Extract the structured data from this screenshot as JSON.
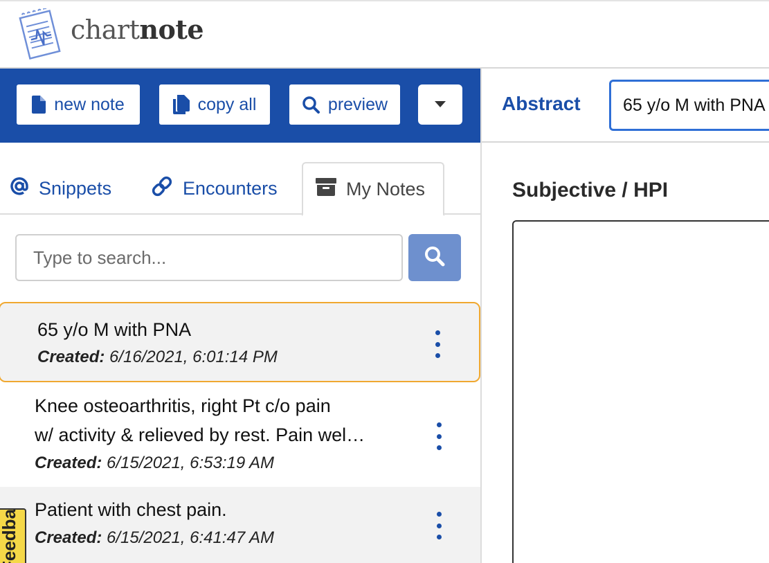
{
  "app": {
    "logo_light": "chart",
    "logo_bold": "note"
  },
  "toolbar": {
    "new_note_label": "new note",
    "copy_all_label": "copy all",
    "preview_label": "preview",
    "accent_color": "#1a4ea8"
  },
  "abstract": {
    "label": "Abstract",
    "value": "65 y/o M with PNA"
  },
  "tabs": [
    {
      "label": "Snippets",
      "icon": "at-icon"
    },
    {
      "label": "Encounters",
      "icon": "link-icon"
    },
    {
      "label": "My Notes",
      "icon": "archive-icon",
      "active": true
    }
  ],
  "search": {
    "placeholder": "Type to search..."
  },
  "notes": [
    {
      "title": "65 y/o M with PNA",
      "created_label": "Created:",
      "created": "6/16/2021, 6:01:14 PM",
      "selected": true
    },
    {
      "title_line1": "Knee osteoarthritis, right Pt c/o pain",
      "title_line2": "w/ activity & relieved by rest. Pain wel…",
      "created_label": "Created:",
      "created": "6/15/2021, 6:53:19 AM"
    },
    {
      "title": "Patient with chest pain.",
      "created_label": "Created:",
      "created": "6/15/2021, 6:41:47 AM"
    }
  ],
  "feedback": {
    "label": "Feedback"
  },
  "editor": {
    "section_title": "Subjective / HPI"
  }
}
